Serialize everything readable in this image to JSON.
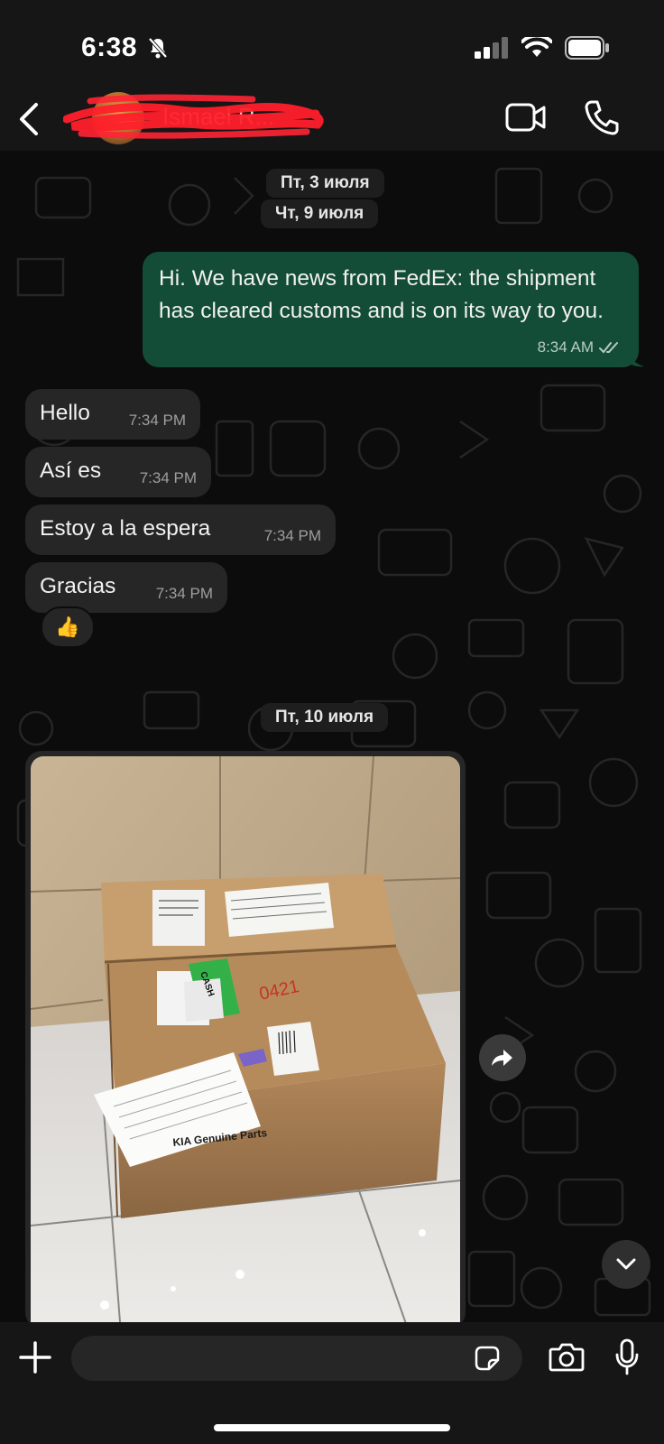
{
  "status_bar": {
    "time": "6:38"
  },
  "header": {
    "contact_name": "Ismael R..."
  },
  "chat": {
    "date_pills": [
      "Пт, 3 июля",
      "Чт, 9 июля",
      "Пт, 10 июля"
    ],
    "outgoing": {
      "text": "Hi. We have news from FedEx: the shipment has cleared customs and is on its way to you.",
      "time": "8:34 AM",
      "status": "read"
    },
    "incoming": [
      {
        "text": "Hello",
        "time": "7:34 PM"
      },
      {
        "text": "Así es",
        "time": "7:34 PM"
      },
      {
        "text": "Estoy a la espera",
        "time": "7:34 PM"
      },
      {
        "text": "Gracias",
        "time": "7:34 PM"
      }
    ],
    "reaction": "👍",
    "photo": {
      "label_cash": "CASH",
      "handwritten": "0421",
      "brand_text": "KIA Genuine Parts"
    }
  },
  "composer": {
    "placeholder": ""
  },
  "colors": {
    "background": "#0b0b0b",
    "outgoing_bubble": "#134d37",
    "incoming_bubble": "#262626",
    "bars": "#161616"
  },
  "icons": [
    "bell-slash-icon",
    "signal-icon",
    "wifi-icon",
    "battery-icon",
    "back-chevron-icon",
    "video-camera-icon",
    "phone-icon",
    "double-check-icon",
    "forward-arrow-icon",
    "chevron-down-icon",
    "plus-icon",
    "sticker-icon",
    "camera-icon",
    "microphone-icon"
  ]
}
